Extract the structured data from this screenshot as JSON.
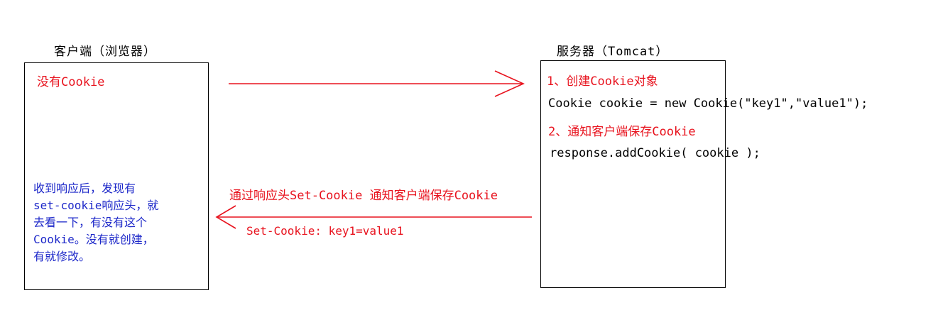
{
  "client": {
    "title": "客户端（浏览器）",
    "no_cookie": "没有Cookie",
    "description_lines": [
      "收到响应后，发现有",
      "set-cookie响应头，就",
      "去看一下，有没有这个",
      "Cookie。没有就创建，",
      "有就修改。"
    ]
  },
  "server": {
    "title": "服务器（Tomcat）",
    "step1": "1、创建Cookie对象",
    "code1": "Cookie cookie = new Cookie(\"key1\",\"value1\");",
    "step2": "2、通知客户端保存Cookie",
    "code2": "response.addCookie( cookie );"
  },
  "response": {
    "label": "通过响应头Set-Cookie 通知客户端保存Cookie",
    "header": "Set-Cookie: key1=value1"
  },
  "colors": {
    "red": "#e8131e",
    "blue": "#1d28c9",
    "black": "#000000"
  }
}
